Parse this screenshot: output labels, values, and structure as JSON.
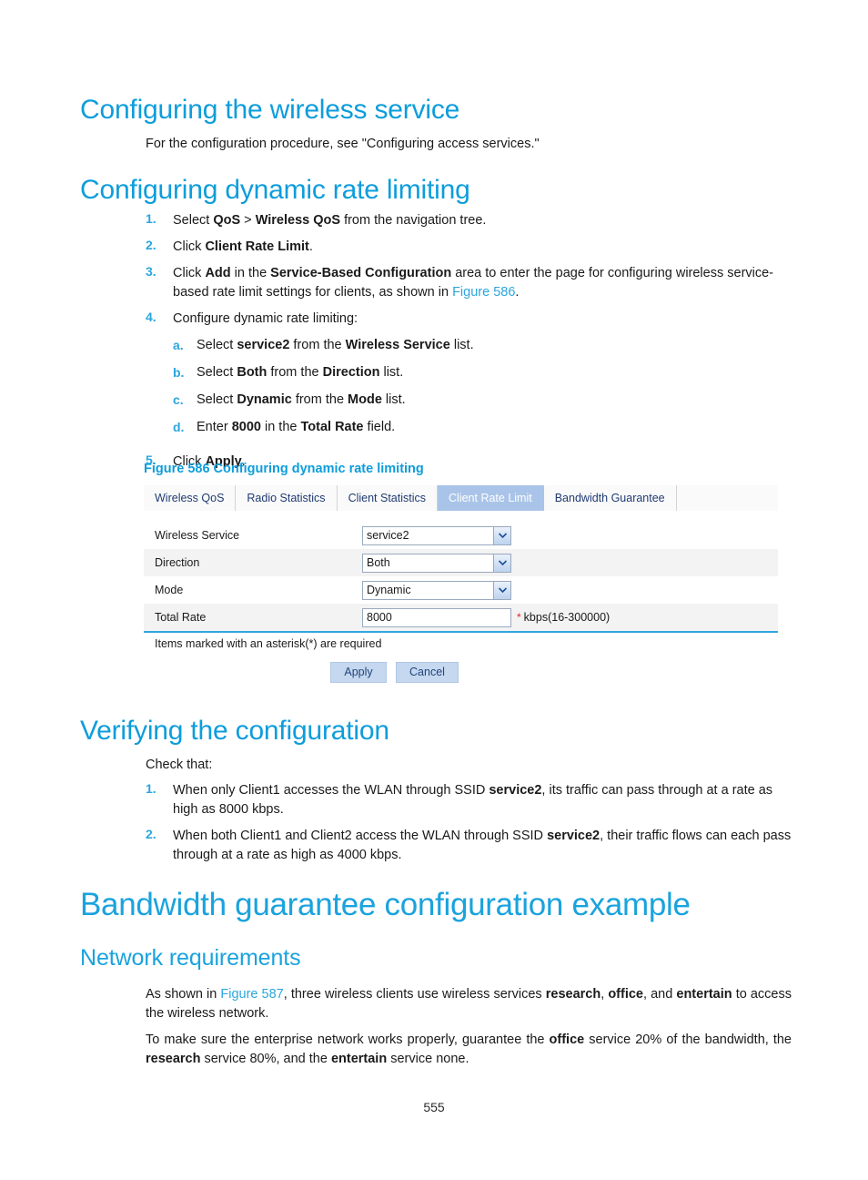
{
  "page": {
    "number": "555",
    "accent_color": "#0d9ddb",
    "link_color": "#2ba6de"
  },
  "sections": {
    "wireless_service": {
      "heading": "Configuring the wireless service",
      "paragraph": "For the configuration procedure, see \"Configuring access services.\""
    },
    "dynamic_rate_limiting": {
      "heading": "Configuring dynamic rate limiting",
      "steps": [
        {
          "num": "1.",
          "parts": [
            {
              "t": "Select ",
              "s": "n"
            },
            {
              "t": "QoS",
              "s": "b"
            },
            {
              "t": " > ",
              "s": "n"
            },
            {
              "t": "Wireless QoS",
              "s": "b"
            },
            {
              "t": " from the navigation tree.",
              "s": "n"
            }
          ]
        },
        {
          "num": "2.",
          "parts": [
            {
              "t": "Click ",
              "s": "n"
            },
            {
              "t": "Client Rate Limit",
              "s": "b"
            },
            {
              "t": ".",
              "s": "n"
            }
          ]
        },
        {
          "num": "3.",
          "parts": [
            {
              "t": "Click ",
              "s": "n"
            },
            {
              "t": "Add",
              "s": "b"
            },
            {
              "t": " in the ",
              "s": "n"
            },
            {
              "t": "Service-Based Configuration",
              "s": "b"
            },
            {
              "t": " area to enter the page for configuring wireless service-based rate limit settings for clients, as shown in ",
              "s": "n"
            },
            {
              "t": "Figure 586",
              "s": "l"
            },
            {
              "t": ".",
              "s": "n"
            }
          ]
        },
        {
          "num": "4.",
          "parts": [
            {
              "t": "Configure dynamic rate limiting:",
              "s": "n"
            }
          ],
          "substeps": [
            {
              "num": "a.",
              "parts": [
                {
                  "t": "Select ",
                  "s": "n"
                },
                {
                  "t": "service2",
                  "s": "b"
                },
                {
                  "t": " from the ",
                  "s": "n"
                },
                {
                  "t": "Wireless Service",
                  "s": "b"
                },
                {
                  "t": " list.",
                  "s": "n"
                }
              ]
            },
            {
              "num": "b.",
              "parts": [
                {
                  "t": "Select ",
                  "s": "n"
                },
                {
                  "t": "Both",
                  "s": "b"
                },
                {
                  "t": " from the ",
                  "s": "n"
                },
                {
                  "t": "Direction",
                  "s": "b"
                },
                {
                  "t": " list.",
                  "s": "n"
                }
              ]
            },
            {
              "num": "c.",
              "parts": [
                {
                  "t": "Select ",
                  "s": "n"
                },
                {
                  "t": "Dynamic",
                  "s": "b"
                },
                {
                  "t": " from the ",
                  "s": "n"
                },
                {
                  "t": "Mode",
                  "s": "b"
                },
                {
                  "t": " list.",
                  "s": "n"
                }
              ]
            },
            {
              "num": "d.",
              "parts": [
                {
                  "t": "Enter ",
                  "s": "n"
                },
                {
                  "t": "8000",
                  "s": "b"
                },
                {
                  "t": " in the ",
                  "s": "n"
                },
                {
                  "t": "Total Rate",
                  "s": "b"
                },
                {
                  "t": " field.",
                  "s": "n"
                }
              ]
            }
          ]
        },
        {
          "num": "5.",
          "parts": [
            {
              "t": "Click ",
              "s": "n"
            },
            {
              "t": "Apply",
              "s": "b"
            },
            {
              "t": ".",
              "s": "n"
            }
          ]
        }
      ]
    },
    "verifying": {
      "heading": "Verifying the configuration",
      "intro": "Check that:",
      "steps": [
        {
          "num": "1.",
          "parts": [
            {
              "t": "When only Client1 accesses the WLAN through SSID ",
              "s": "n"
            },
            {
              "t": "service2",
              "s": "b"
            },
            {
              "t": ", its traffic can pass through at a rate as high as 8000 kbps.",
              "s": "n"
            }
          ]
        },
        {
          "num": "2.",
          "parts": [
            {
              "t": "When both Client1 and Client2 access the WLAN through SSID ",
              "s": "n"
            },
            {
              "t": "service2",
              "s": "b"
            },
            {
              "t": ", their traffic flows can each pass through at a rate as high as 4000 kbps.",
              "s": "n"
            }
          ]
        }
      ]
    },
    "bandwidth_example": {
      "heading": "Bandwidth guarantee configuration example",
      "subheading": "Network requirements",
      "paragraph1": [
        {
          "t": "As shown in ",
          "s": "n"
        },
        {
          "t": "Figure 587",
          "s": "l"
        },
        {
          "t": ", three wireless clients use wireless services ",
          "s": "n"
        },
        {
          "t": "research",
          "s": "b"
        },
        {
          "t": ", ",
          "s": "n"
        },
        {
          "t": "office",
          "s": "b"
        },
        {
          "t": ", and ",
          "s": "n"
        },
        {
          "t": "entertain",
          "s": "b"
        },
        {
          "t": " to access the wireless network.",
          "s": "n"
        }
      ],
      "paragraph2": [
        {
          "t": "To make sure the enterprise network works properly, guarantee the ",
          "s": "n"
        },
        {
          "t": "office",
          "s": "b"
        },
        {
          "t": " service 20% of the bandwidth, the ",
          "s": "n"
        },
        {
          "t": "research",
          "s": "b"
        },
        {
          "t": " service 80%, and the ",
          "s": "n"
        },
        {
          "t": "entertain",
          "s": "b"
        },
        {
          "t": " service none.",
          "s": "n"
        }
      ]
    }
  },
  "figure": {
    "caption": "Figure 586 Configuring dynamic rate limiting",
    "tabs": [
      {
        "label": "Wireless QoS",
        "active": false
      },
      {
        "label": "Radio Statistics",
        "active": false
      },
      {
        "label": "Client Statistics",
        "active": false
      },
      {
        "label": "Client Rate Limit",
        "active": true
      },
      {
        "label": "Bandwidth Guarantee",
        "active": false
      }
    ],
    "fields": [
      {
        "label": "Wireless Service",
        "value": "service2",
        "type": "select",
        "required": false,
        "hint": ""
      },
      {
        "label": "Direction",
        "value": "Both",
        "type": "select",
        "required": false,
        "hint": ""
      },
      {
        "label": "Mode",
        "value": "Dynamic",
        "type": "select",
        "required": false,
        "hint": ""
      },
      {
        "label": "Total Rate",
        "value": "8000",
        "type": "text",
        "required": true,
        "hint": "kbps(16-300000)"
      }
    ],
    "required_note": "Items marked with an asterisk(*) are required",
    "buttons": [
      {
        "label": "Apply",
        "name": "apply-button"
      },
      {
        "label": "Cancel",
        "name": "cancel-button"
      }
    ],
    "colors": {
      "active_tab_bg": "#a9c4e8",
      "button_bg": "#c5d8ef",
      "rule": "#2fa8e0",
      "required_star": "#e02020"
    }
  }
}
